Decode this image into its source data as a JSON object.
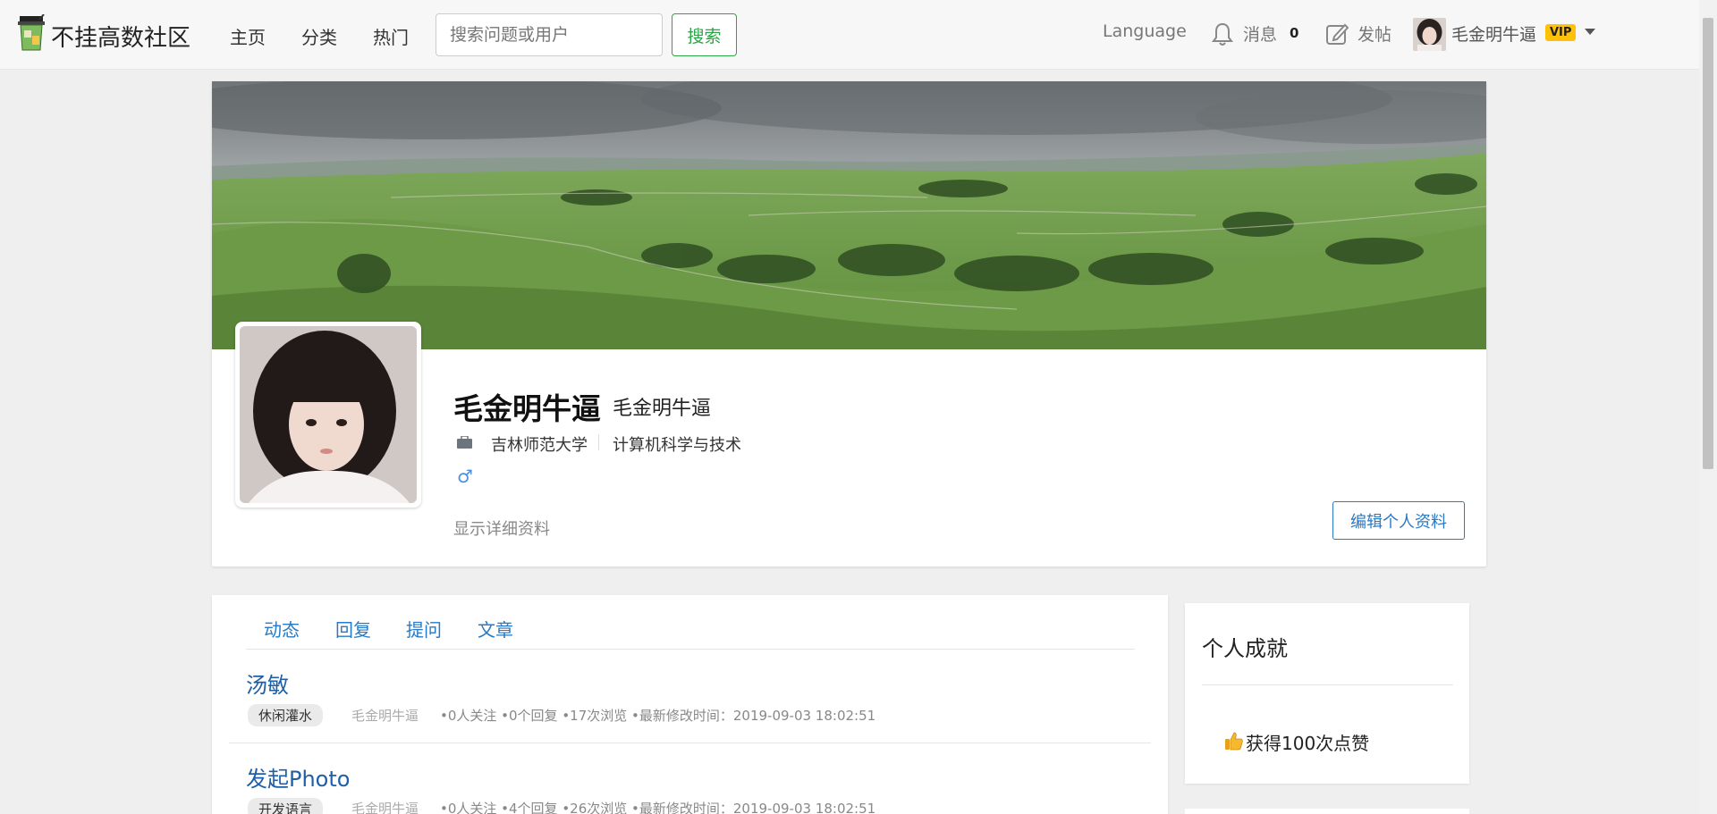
{
  "navbar": {
    "brand": "不挂高数社区",
    "links": [
      "主页",
      "分类",
      "热门"
    ],
    "search_placeholder": "搜索问题或用户",
    "search_button": "搜索",
    "language": "Language",
    "messages_label": "消息",
    "messages_count": "0",
    "post_label": "发帖",
    "username": "毛金明牛逼",
    "vip_badge": "VIP"
  },
  "profile": {
    "name": "毛金明牛逼",
    "nickname": "毛金明牛逼",
    "school": "吉林师范大学",
    "major": "计算机科学与技术",
    "gender_symbol": "♂",
    "detail_link": "显示详细资料",
    "edit_button": "编辑个人资料"
  },
  "feed": {
    "tabs": [
      "动态",
      "回复",
      "提问",
      "文章"
    ],
    "posts": [
      {
        "title": "汤敏",
        "tag": "休闲灌水",
        "author": "毛金明牛逼",
        "meta": "•0人关注 •0个回复 •17次浏览 •最新修改时间：2019-09-03 18:02:51"
      },
      {
        "title": "发起Photo",
        "tag": "开发语言",
        "author": "毛金明牛逼",
        "meta": "•0人关注 •4个回复 •26次浏览 •最新修改时间：2019-09-03 18:02:51"
      }
    ]
  },
  "sidebar": {
    "title": "个人成就",
    "likes": "获得100次点赞"
  },
  "colors": {
    "link_blue": "#2879c6",
    "search_green": "#28a745",
    "vip_yellow": "#ffc107"
  }
}
